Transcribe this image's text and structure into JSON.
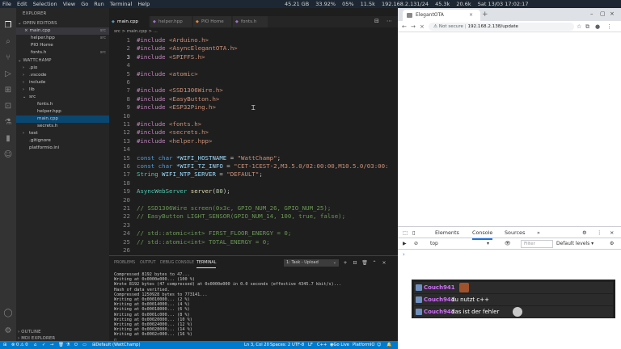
{
  "system_bar": {
    "menu": [
      "File",
      "Edit",
      "Selection",
      "View",
      "Go",
      "Run",
      "Terminal",
      "Help"
    ],
    "stats": [
      "45.21 GB",
      "33.92%",
      "05%",
      "11.5k",
      "192.168.2.131/24",
      "45.3k",
      "20.6k",
      "Sat 13/03 17:02:17"
    ]
  },
  "vscode": {
    "sidebar": {
      "explorer_title": "EXPLORER",
      "open_editors_title": "OPEN EDITORS",
      "open_editors": [
        {
          "label": "main.cpp",
          "badge": "src"
        },
        {
          "label": "helper.hpp",
          "badge": "src"
        },
        {
          "label": "PIO Home",
          "badge": ""
        },
        {
          "label": "fonts.h",
          "badge": "src"
        }
      ],
      "project_title": "WATTCHAMP",
      "tree": [
        {
          "label": ".pio",
          "type": "folder"
        },
        {
          "label": ".vscode",
          "type": "folder"
        },
        {
          "label": "include",
          "type": "folder"
        },
        {
          "label": "lib",
          "type": "folder"
        },
        {
          "label": "src",
          "type": "folder-open"
        },
        {
          "label": "fonts.h",
          "type": "file"
        },
        {
          "label": "helper.hpp",
          "type": "file"
        },
        {
          "label": "main.cpp",
          "type": "file"
        },
        {
          "label": "secrets.h",
          "type": "file"
        },
        {
          "label": "test",
          "type": "folder"
        },
        {
          "label": ".gitignore",
          "type": "file"
        },
        {
          "label": "platformio.ini",
          "type": "file"
        }
      ],
      "outline_title": "OUTLINE",
      "mdi_title": "MDI EXPLORER"
    },
    "tabs": [
      {
        "label": "main.cpp",
        "active": true
      },
      {
        "label": "helper.hpp",
        "active": false
      },
      {
        "label": "PIO Home",
        "active": false
      },
      {
        "label": "fonts.h",
        "active": false
      }
    ],
    "breadcrumb": "src > main.cpp > ...",
    "code_lines": [
      {
        "n": "1",
        "parts": [
          [
            "k",
            "#include "
          ],
          [
            "s",
            "<Arduino.h>"
          ]
        ]
      },
      {
        "n": "2",
        "parts": [
          [
            "k",
            "#include "
          ],
          [
            "s",
            "<AsyncElegantOTA.h>"
          ]
        ]
      },
      {
        "n": "3",
        "parts": [
          [
            "k",
            "#include "
          ],
          [
            "s",
            "<SPIFFS.h>"
          ]
        ]
      },
      {
        "n": "4",
        "parts": []
      },
      {
        "n": "5",
        "parts": [
          [
            "k",
            "#include "
          ],
          [
            "s",
            "<atomic>"
          ]
        ]
      },
      {
        "n": "6",
        "parts": []
      },
      {
        "n": "7",
        "parts": [
          [
            "k",
            "#include "
          ],
          [
            "s",
            "<SSD1306Wire.h>"
          ]
        ]
      },
      {
        "n": "8",
        "parts": [
          [
            "k",
            "#include "
          ],
          [
            "s",
            "<EasyButton.h>"
          ]
        ]
      },
      {
        "n": "9",
        "parts": [
          [
            "k",
            "#include "
          ],
          [
            "s",
            "<ESP32Ping.h>"
          ]
        ]
      },
      {
        "n": "10",
        "parts": []
      },
      {
        "n": "11",
        "parts": [
          [
            "k",
            "#include "
          ],
          [
            "s",
            "<fonts.h>"
          ]
        ]
      },
      {
        "n": "12",
        "parts": [
          [
            "k",
            "#include "
          ],
          [
            "s",
            "<secrets.h>"
          ]
        ]
      },
      {
        "n": "13",
        "parts": [
          [
            "k",
            "#include "
          ],
          [
            "s",
            "<helper.hpp>"
          ]
        ]
      },
      {
        "n": "14",
        "parts": []
      },
      {
        "n": "15",
        "parts": [
          [
            "t",
            "const "
          ],
          [
            "t",
            "char "
          ],
          [
            "v",
            "*WIFI_HOSTNAME"
          ],
          [
            "p",
            " = "
          ],
          [
            "s",
            "\"WattChamp\""
          ],
          [
            "p",
            ";"
          ]
        ]
      },
      {
        "n": "16",
        "parts": [
          [
            "t",
            "const "
          ],
          [
            "t",
            "char "
          ],
          [
            "v",
            "*WIFI_TZ_INFO"
          ],
          [
            "p",
            " = "
          ],
          [
            "s",
            "\"CET-1CEST-2,M3.5.0/02:00:00,M10.5.0/03:00:"
          ]
        ]
      },
      {
        "n": "17",
        "parts": [
          [
            "ty",
            "String "
          ],
          [
            "v",
            "WIFI_NTP_SERVER"
          ],
          [
            "p",
            " = "
          ],
          [
            "s",
            "\"DEFAULT\""
          ],
          [
            "p",
            ";"
          ]
        ]
      },
      {
        "n": "18",
        "parts": []
      },
      {
        "n": "19",
        "parts": [
          [
            "ty",
            "AsyncWebServer "
          ],
          [
            "f",
            "server"
          ],
          [
            "p",
            "("
          ],
          [
            "n",
            "80"
          ],
          [
            "p",
            ");"
          ]
        ]
      },
      {
        "n": "20",
        "parts": []
      },
      {
        "n": "21",
        "parts": [
          [
            "c",
            "// SSD1306Wire screen(0x3c, GPIO_NUM_26, GPIO_NUM_25);"
          ]
        ]
      },
      {
        "n": "22",
        "parts": [
          [
            "c",
            "// EasyButton LIGHT_SENSOR(GPIO_NUM_14, 100, true, false);"
          ]
        ]
      },
      {
        "n": "23",
        "parts": []
      },
      {
        "n": "24",
        "parts": [
          [
            "c",
            "// std::atomic<int> FIRST_FLOOR_ENERGY = 0;"
          ]
        ]
      },
      {
        "n": "25",
        "parts": [
          [
            "c",
            "// std::atomic<int> TOTAL_ENERGY = 0;"
          ]
        ]
      },
      {
        "n": "26",
        "parts": []
      }
    ],
    "panel_tabs": [
      "PROBLEMS",
      "OUTPUT",
      "DEBUG CONSOLE",
      "TERMINAL"
    ],
    "task_select": "1: Task - Upload",
    "terminal_lines": [
      "Compressed 8192 bytes to 47...",
      "Writing at 0x0000e000... (100 %)",
      "Wrote 8192 bytes (47 compressed) at 0x0000e000 in 0.0 seconds (effective 4345.7 kbit/s)...",
      "Hash of data verified.",
      "Compressed 1250928 bytes to 773141...",
      "Writing at 0x00010000... (2 %)",
      "Writing at 0x00014000... (4 %)",
      "Writing at 0x00018000... (6 %)",
      "Writing at 0x0001c000... (8 %)",
      "Writing at 0x00020000... (10 %)",
      "Writing at 0x00024000... (12 %)",
      "Writing at 0x00028000... (14 %)",
      "Writing at 0x0002c000... (16 %)"
    ],
    "statusbar": {
      "env": "Default (WattChamp)",
      "position": "Ln 3, Col 20",
      "spaces": "Spaces: 2",
      "encoding": "UTF-8",
      "eol": "LF",
      "lang": "C++",
      "golive": "Go Live",
      "pio": "PlatformIO"
    }
  },
  "browser": {
    "tab_title": "ElegantOTA",
    "not_secure": "Not secure",
    "url": "192.168.2.138/update",
    "devtools_tabs": [
      "Elements",
      "Console",
      "Sources"
    ],
    "context": "top",
    "filter_placeholder": "Filter",
    "levels": "Default levels"
  },
  "chat": [
    {
      "user": "Couch941",
      "message": ""
    },
    {
      "user": "Couch941",
      "message": "du nutzt c++"
    },
    {
      "user": "Couch941",
      "message": "das ist der fehler"
    }
  ]
}
